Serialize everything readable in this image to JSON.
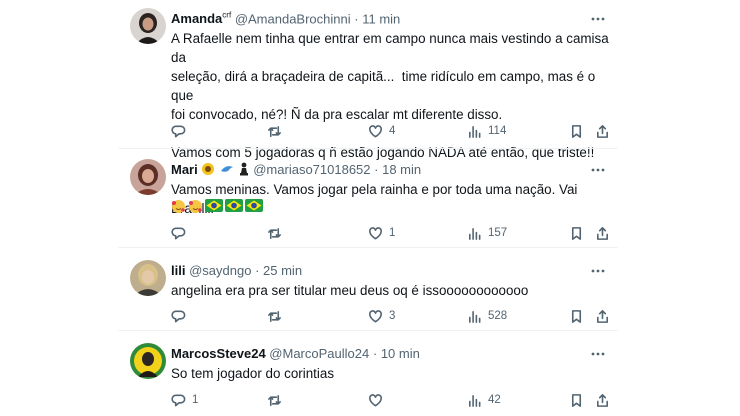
{
  "tweets": [
    {
      "name": "Amanda",
      "name_sup": "crf",
      "handle": "@AmandaBrochinni",
      "time": "11 min",
      "text": "A Rafaelle nem tinha que entrar em campo nunca mais vestindo a camisa da\nseleção, dirá a braçadeira de capitã...  time ridículo em campo, mas é o que\nfoi convocado, né?! Ñ da pra escalar mt diferente disso.\n\nVamos com 5 jogadoras q ñ estão jogando NADA até então, que triste!!",
      "replies": "",
      "retweets": "",
      "likes": "4",
      "views": "114"
    },
    {
      "name": "Mari",
      "handle": "@mariaso71018652",
      "time": "18 min",
      "text": "Vamos meninas. Vamos jogar pela rainha e por toda uma nação. Vai Brasilll.",
      "replies": "",
      "retweets": "",
      "likes": "1",
      "views": "157"
    },
    {
      "name": "lili",
      "handle": "@saydngo",
      "time": "25 min",
      "text": "angelina era pra ser titular meu deus oq é issoooooooooooo",
      "replies": "",
      "retweets": "",
      "likes": "3",
      "views": "528"
    },
    {
      "name": "MarcosSteve24",
      "handle": "@MarcoPaullo24",
      "time": "10 min",
      "text": "So tem jogador do corintias",
      "replies": "1",
      "retweets": "",
      "likes": "",
      "views": "42"
    }
  ],
  "separator": "·",
  "colors": {
    "text": "#0f1419",
    "secondary": "#536471",
    "border": "#eff3f4",
    "background": "#ffffff"
  }
}
